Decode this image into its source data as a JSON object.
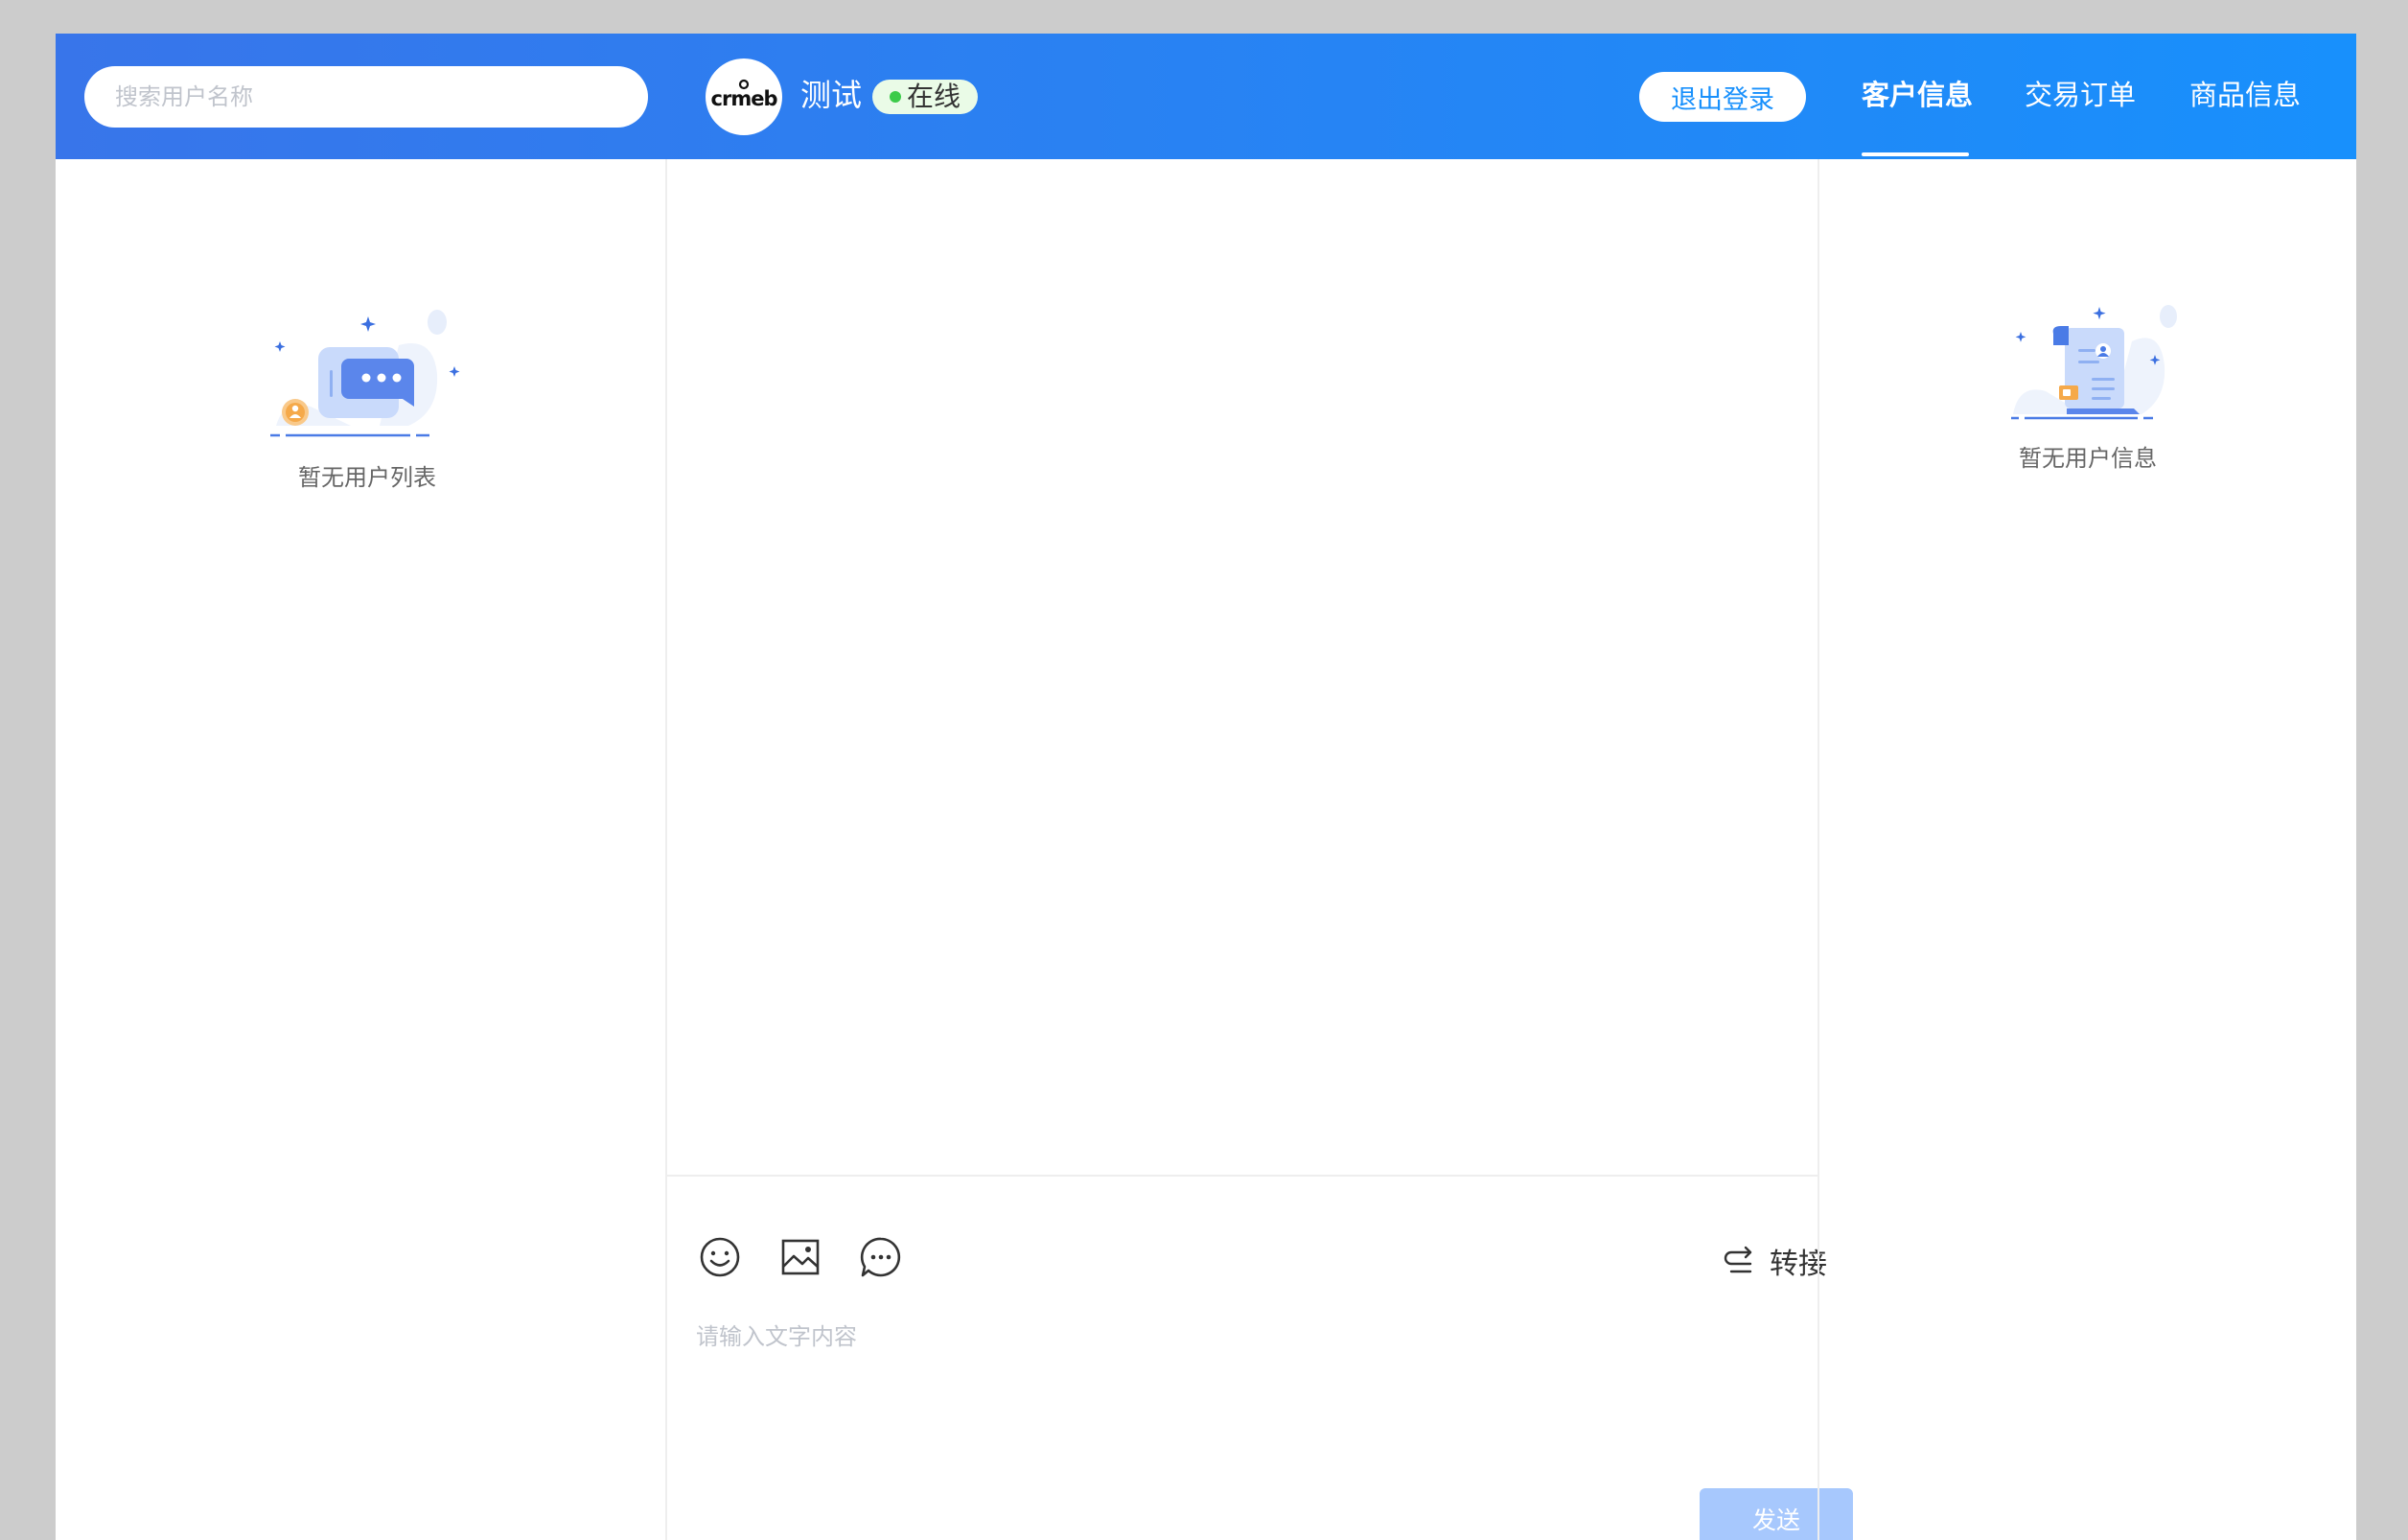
{
  "header": {
    "search": {
      "placeholder": "搜索用户名称"
    },
    "logo_text": "crmeb",
    "kf_name": "测试",
    "status": "在线",
    "logout_label": "退出登录",
    "tabs": [
      {
        "label": "客户信息",
        "active": true
      },
      {
        "label": "交易订单",
        "active": false
      },
      {
        "label": "商品信息",
        "active": false
      }
    ]
  },
  "user_list": {
    "empty_text": "暂无用户列表"
  },
  "chat": {
    "toolbar": {
      "icons": [
        "emoji-icon",
        "image-icon",
        "quick-reply-icon"
      ],
      "transfer_label": "转接"
    },
    "input": {
      "placeholder": "请输入文字内容"
    },
    "send_label": "发送"
  },
  "user_info": {
    "empty_text": "暂无用户信息"
  },
  "colors": {
    "header_gradient_start": "#3875ea",
    "header_gradient_end": "#1890fc",
    "status_dot": "#3ccb4a",
    "send_disabled": "#a7c8fd"
  }
}
